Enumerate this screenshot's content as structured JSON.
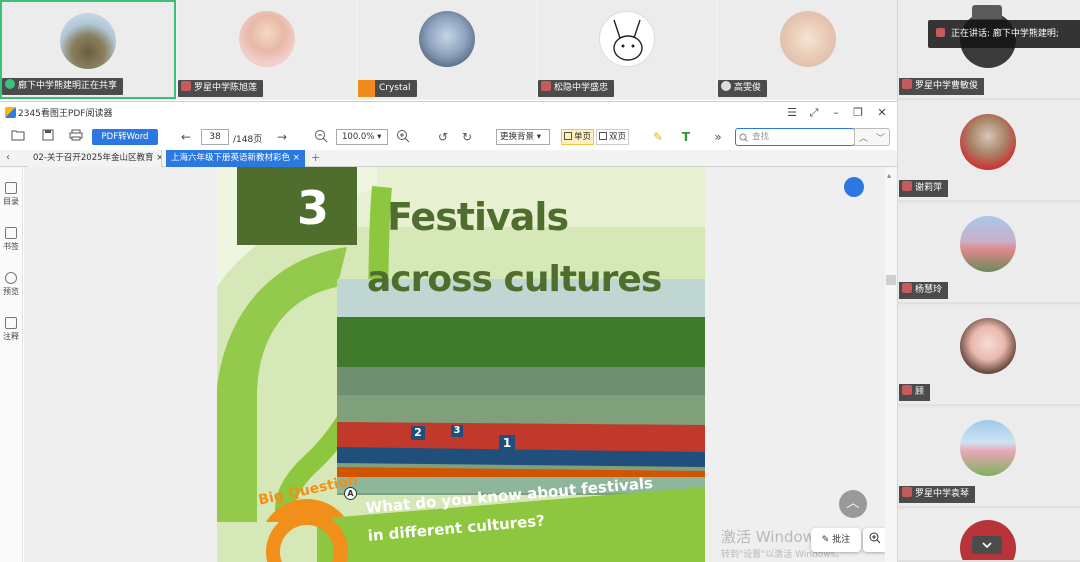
{
  "participants_top": [
    {
      "name": "廊下中学熊建明正在共享",
      "active": true
    },
    {
      "name": "罗星中学陈旭莲"
    },
    {
      "name": "Crystal"
    },
    {
      "name": "松隐中学盛忠"
    },
    {
      "name": "高雯俊"
    }
  ],
  "participants_right": [
    {
      "name": "罗星中学曹敏俊"
    },
    {
      "name": "谢莉萍"
    },
    {
      "name": "杨慧玲"
    },
    {
      "name": "顾"
    },
    {
      "name": "罗星中学袁琴"
    }
  ],
  "speaking_label": "正在讲话: 廊下中学熊建明;",
  "reader": {
    "app_title": "2345看图王PDF阅读器",
    "pdf_to_word": "PDF转Word",
    "page_current": "38",
    "page_total": "/148页",
    "zoom": "100.0%",
    "background_btn": "更换背景 ▾",
    "single_page": "单页",
    "double_page": "双页",
    "search_placeholder": "查找",
    "tabs": [
      {
        "label": "02-关于召开2025年金山区教育 ×"
      },
      {
        "label": "上海六年级下册英语新教材彩色 ×",
        "active": true
      }
    ],
    "sidenav": [
      {
        "label": "目录"
      },
      {
        "label": "书签"
      },
      {
        "label": "预览"
      },
      {
        "label": "注释"
      }
    ],
    "annotate_btn": "批注",
    "watermark_line1": "激活 Windows",
    "watermark_line2": "转到\"设置\"以激活 Windows。"
  },
  "pdf_page": {
    "unit_number": "3",
    "title_line1": "Festivals",
    "title_line2": "across cultures",
    "big_question_label": "Big Question",
    "question_line1": "What do you know about festivals",
    "question_line2": "in different cultures?",
    "marker_a": "A",
    "boat_numbers": [
      "2",
      "3",
      "1"
    ]
  },
  "colors": {
    "accent_blue": "#2b79e0",
    "speaker_green": "#3bc07e",
    "pdf_green": "#8dc63f",
    "pdf_dark_green": "#4f6d2d"
  }
}
